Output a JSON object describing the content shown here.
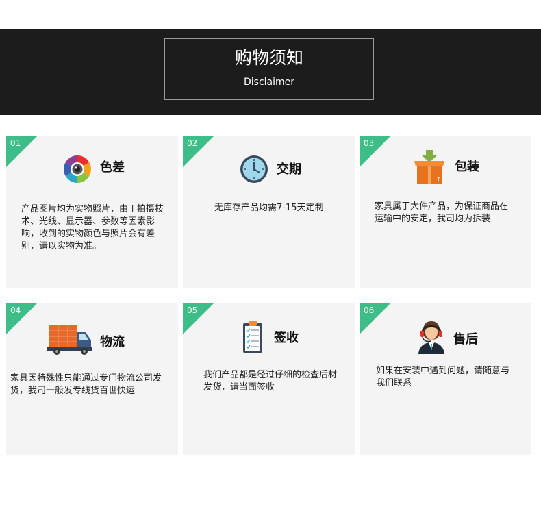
{
  "header": {
    "title": "购物须知",
    "subtitle": "Disclaimer"
  },
  "cards": [
    {
      "num": "01",
      "title": "色差",
      "icon": "camera-lens-icon",
      "desc": "产品图片均为实物照片，由于拍摄技术、光线、显示器、参数等因素影响，收到的实物颜色与照片会有差别，请以实物为准。"
    },
    {
      "num": "02",
      "title": "交期",
      "icon": "clock-icon",
      "desc": "无库存产品均需7-15天定制"
    },
    {
      "num": "03",
      "title": "包装",
      "icon": "package-box-icon",
      "desc": "家具属于大件产品，为保证商品在运输中的安定，我司均为拆装"
    },
    {
      "num": "04",
      "title": "物流",
      "icon": "delivery-truck-icon",
      "desc": "家具因特殊性只能通过专门物流公司发货，我司一般发专线货百世快运"
    },
    {
      "num": "05",
      "title": "签收",
      "icon": "clipboard-checklist-icon",
      "desc": "我们产品都是经过仔细的检查后材发货，请当面签收"
    },
    {
      "num": "06",
      "title": "售后",
      "icon": "customer-service-headset-icon",
      "desc": "如果在安装中遇到问题，请随意与我们联系"
    }
  ],
  "colors": {
    "banner_bg": "#1c1c1c",
    "card_bg": "#f4f4f4",
    "corner_accent": "#3dbe89"
  }
}
